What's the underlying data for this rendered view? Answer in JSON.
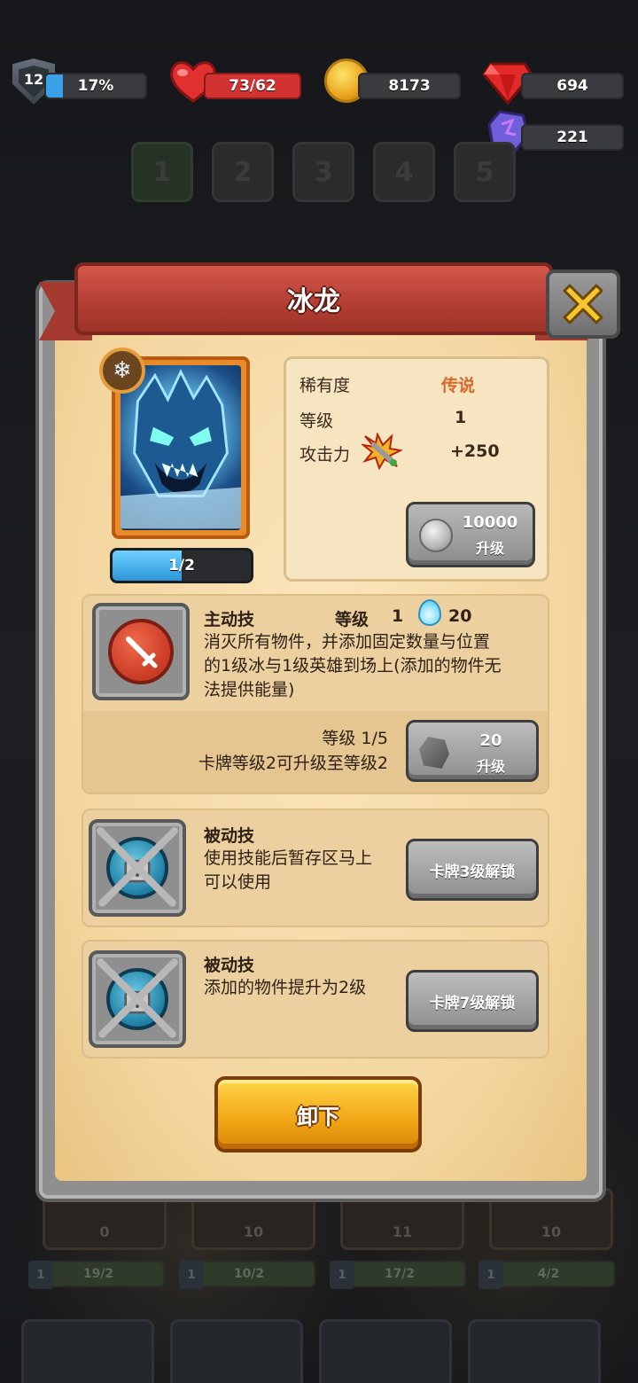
{
  "hud": {
    "level_badge": "12",
    "level_progress_percent": "17%",
    "level_progress_fraction": 0.17,
    "health": "73/62",
    "gold": "8173",
    "gems": "694",
    "crystals": "221"
  },
  "tabs": [
    "1",
    "2",
    "3",
    "4",
    "5"
  ],
  "active_tab_index": 0,
  "card": {
    "name": "冰龙",
    "element_icon": "snowflake-icon",
    "progress_text": "1/2",
    "progress_fraction": 0.5,
    "stats": {
      "rarity_label": "稀有度",
      "rarity_value": "传说",
      "level_label": "等级",
      "level_value": "1",
      "attack_label": "攻击力",
      "attack_value": "+250"
    },
    "upgrade": {
      "cost": "10000",
      "label": "升级"
    }
  },
  "active_skill": {
    "type_label": "主动技",
    "level_label": "等级",
    "level_value": "1",
    "energy_cost": "20",
    "description_lines": [
      "消灭所有物件，并添加固定数量与位置",
      "的1级冰与1级英雄到场上(添加的物件无",
      "法提供能量)"
    ],
    "skill_level_text": "等级 1/5",
    "requirement_text": "卡牌等级2可升级至等级2",
    "upgrade_cost": "20",
    "upgrade_label": "升级"
  },
  "passive_skills": [
    {
      "type_label": "被动技",
      "description_lines": [
        "使用技能后暂存区马上",
        "可以使用"
      ],
      "unlock_label": "卡牌3级解锁"
    },
    {
      "type_label": "被动技",
      "description_lines": [
        "添加的物件提升为2级"
      ],
      "unlock_label": "卡牌7级解锁"
    }
  ],
  "unload_button": "卸下",
  "background_cards": [
    {
      "count": "0",
      "level": "1",
      "progress": "19/2"
    },
    {
      "count": "10",
      "level": "1",
      "progress": "10/2"
    },
    {
      "count": "11",
      "level": "1",
      "progress": "17/2"
    },
    {
      "count": "10",
      "level": "1",
      "progress": "4/2"
    }
  ],
  "colors": {
    "banner_red": "#b23e33",
    "parchment": "#f3d59e",
    "legendary_orange": "#d8672a",
    "unload_yellow": "#f0a514",
    "progress_blue": "#2d95d8"
  }
}
